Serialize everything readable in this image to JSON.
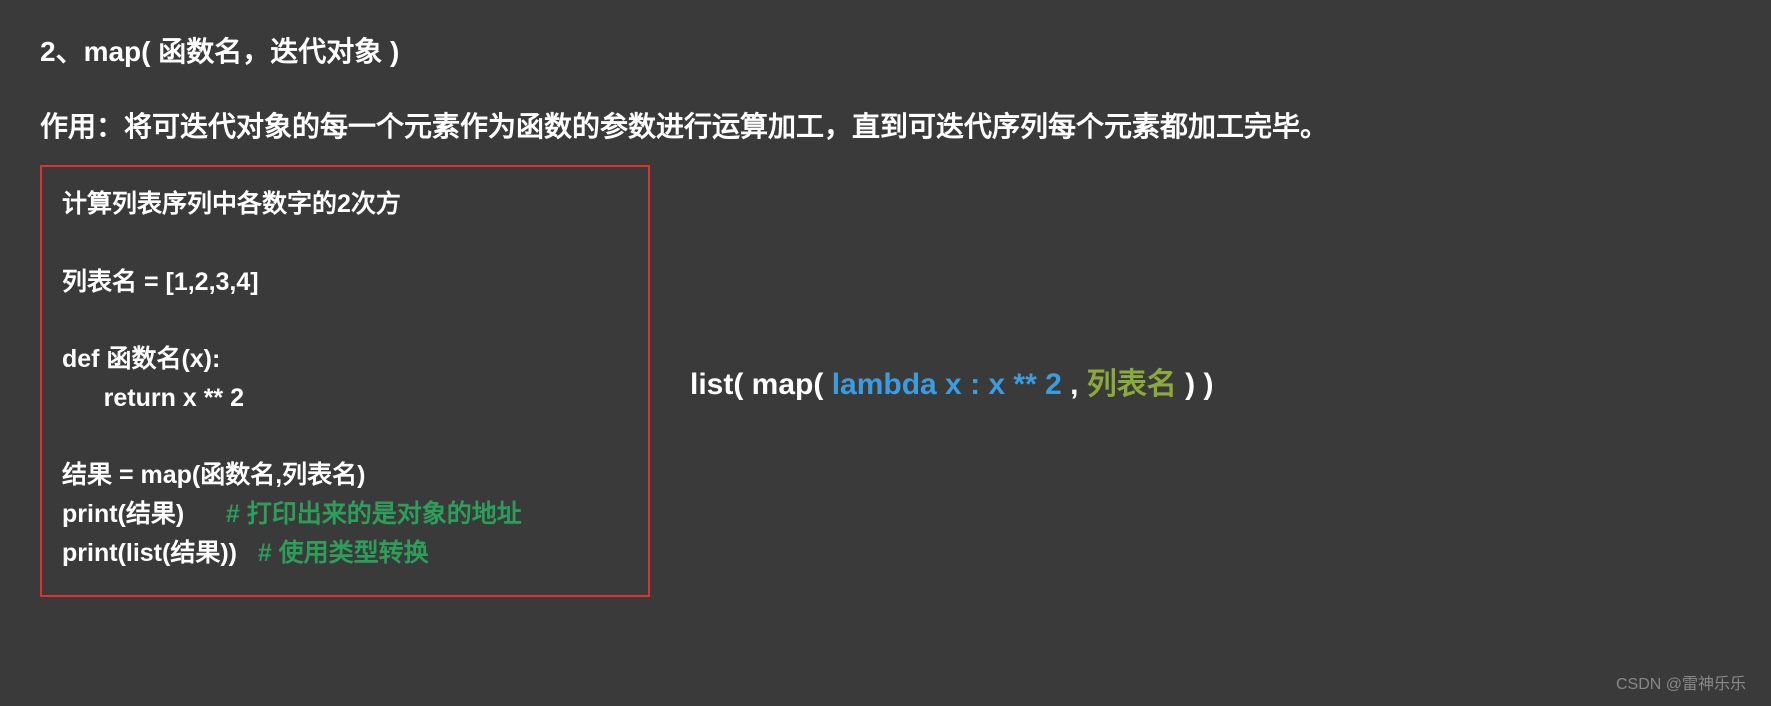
{
  "title": "2、map( 函数名，迭代对象 )",
  "description": "作用：将可迭代对象的每一个元素作为函数的参数进行运算加工，直到可迭代序列每个元素都加工完毕。",
  "codebox": {
    "line1": "计算列表序列中各数字的2次方",
    "line2": "",
    "line3": "列表名 = [1,2,3,4]",
    "line4": "",
    "line5": "def 函数名(x):",
    "line6": "      return x ** 2",
    "line7": "",
    "line8": "结果 = map(函数名,列表名)",
    "line9a": "print(结果)      ",
    "line9b": "# 打印出来的是对象的地址",
    "line10a": "print(list(结果))   ",
    "line10b": "# 使用类型转换"
  },
  "lambda": {
    "p1": "list( map( ",
    "p2": "lambda x : x ** 2 ",
    "p3": ", ",
    "p4": "列表名 ",
    "p5": ") )"
  },
  "watermark": "CSDN @雷神乐乐"
}
